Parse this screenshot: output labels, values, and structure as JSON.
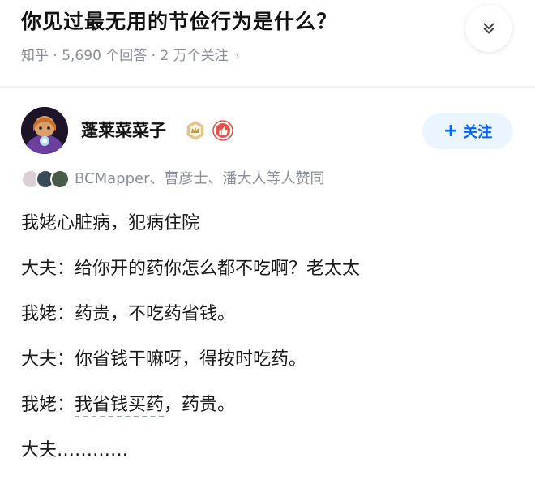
{
  "question": {
    "title": "你见过最无用的节俭行为是什么？",
    "meta": "知乎 · 5,690 个回答 · 2 万个关注",
    "meta_chevron": "›"
  },
  "icons": {
    "collapse": "chevron-double-down-icon",
    "meta_chevron": "chevron-right-icon",
    "badge_a": "creator-level-badge-icon",
    "badge_b": "like-badge-icon"
  },
  "author": {
    "name": "蓬莱菜菜子",
    "follow_plus": "+",
    "follow_label": "关注"
  },
  "likers": {
    "text": "BCMapper、曹彦士、潘大人等人赞同"
  },
  "answer": {
    "paragraphs": [
      "我姥心脏病，犯病住院",
      "大夫：给你开的药你怎么都不吃啊？老太太",
      "我姥：药贵，不吃药省钱。",
      "大夫：你省钱干嘛呀，得按时吃药。",
      "大夫…………"
    ],
    "p5_prefix": "我姥：",
    "p5_underlined": "我省钱买药",
    "p5_suffix": "，药贵。"
  },
  "colors": {
    "brand_blue": "#0066ff",
    "follow_bg": "#ebf5ff",
    "meta_gray": "#8a8f99",
    "text": "#1a1a1a"
  }
}
